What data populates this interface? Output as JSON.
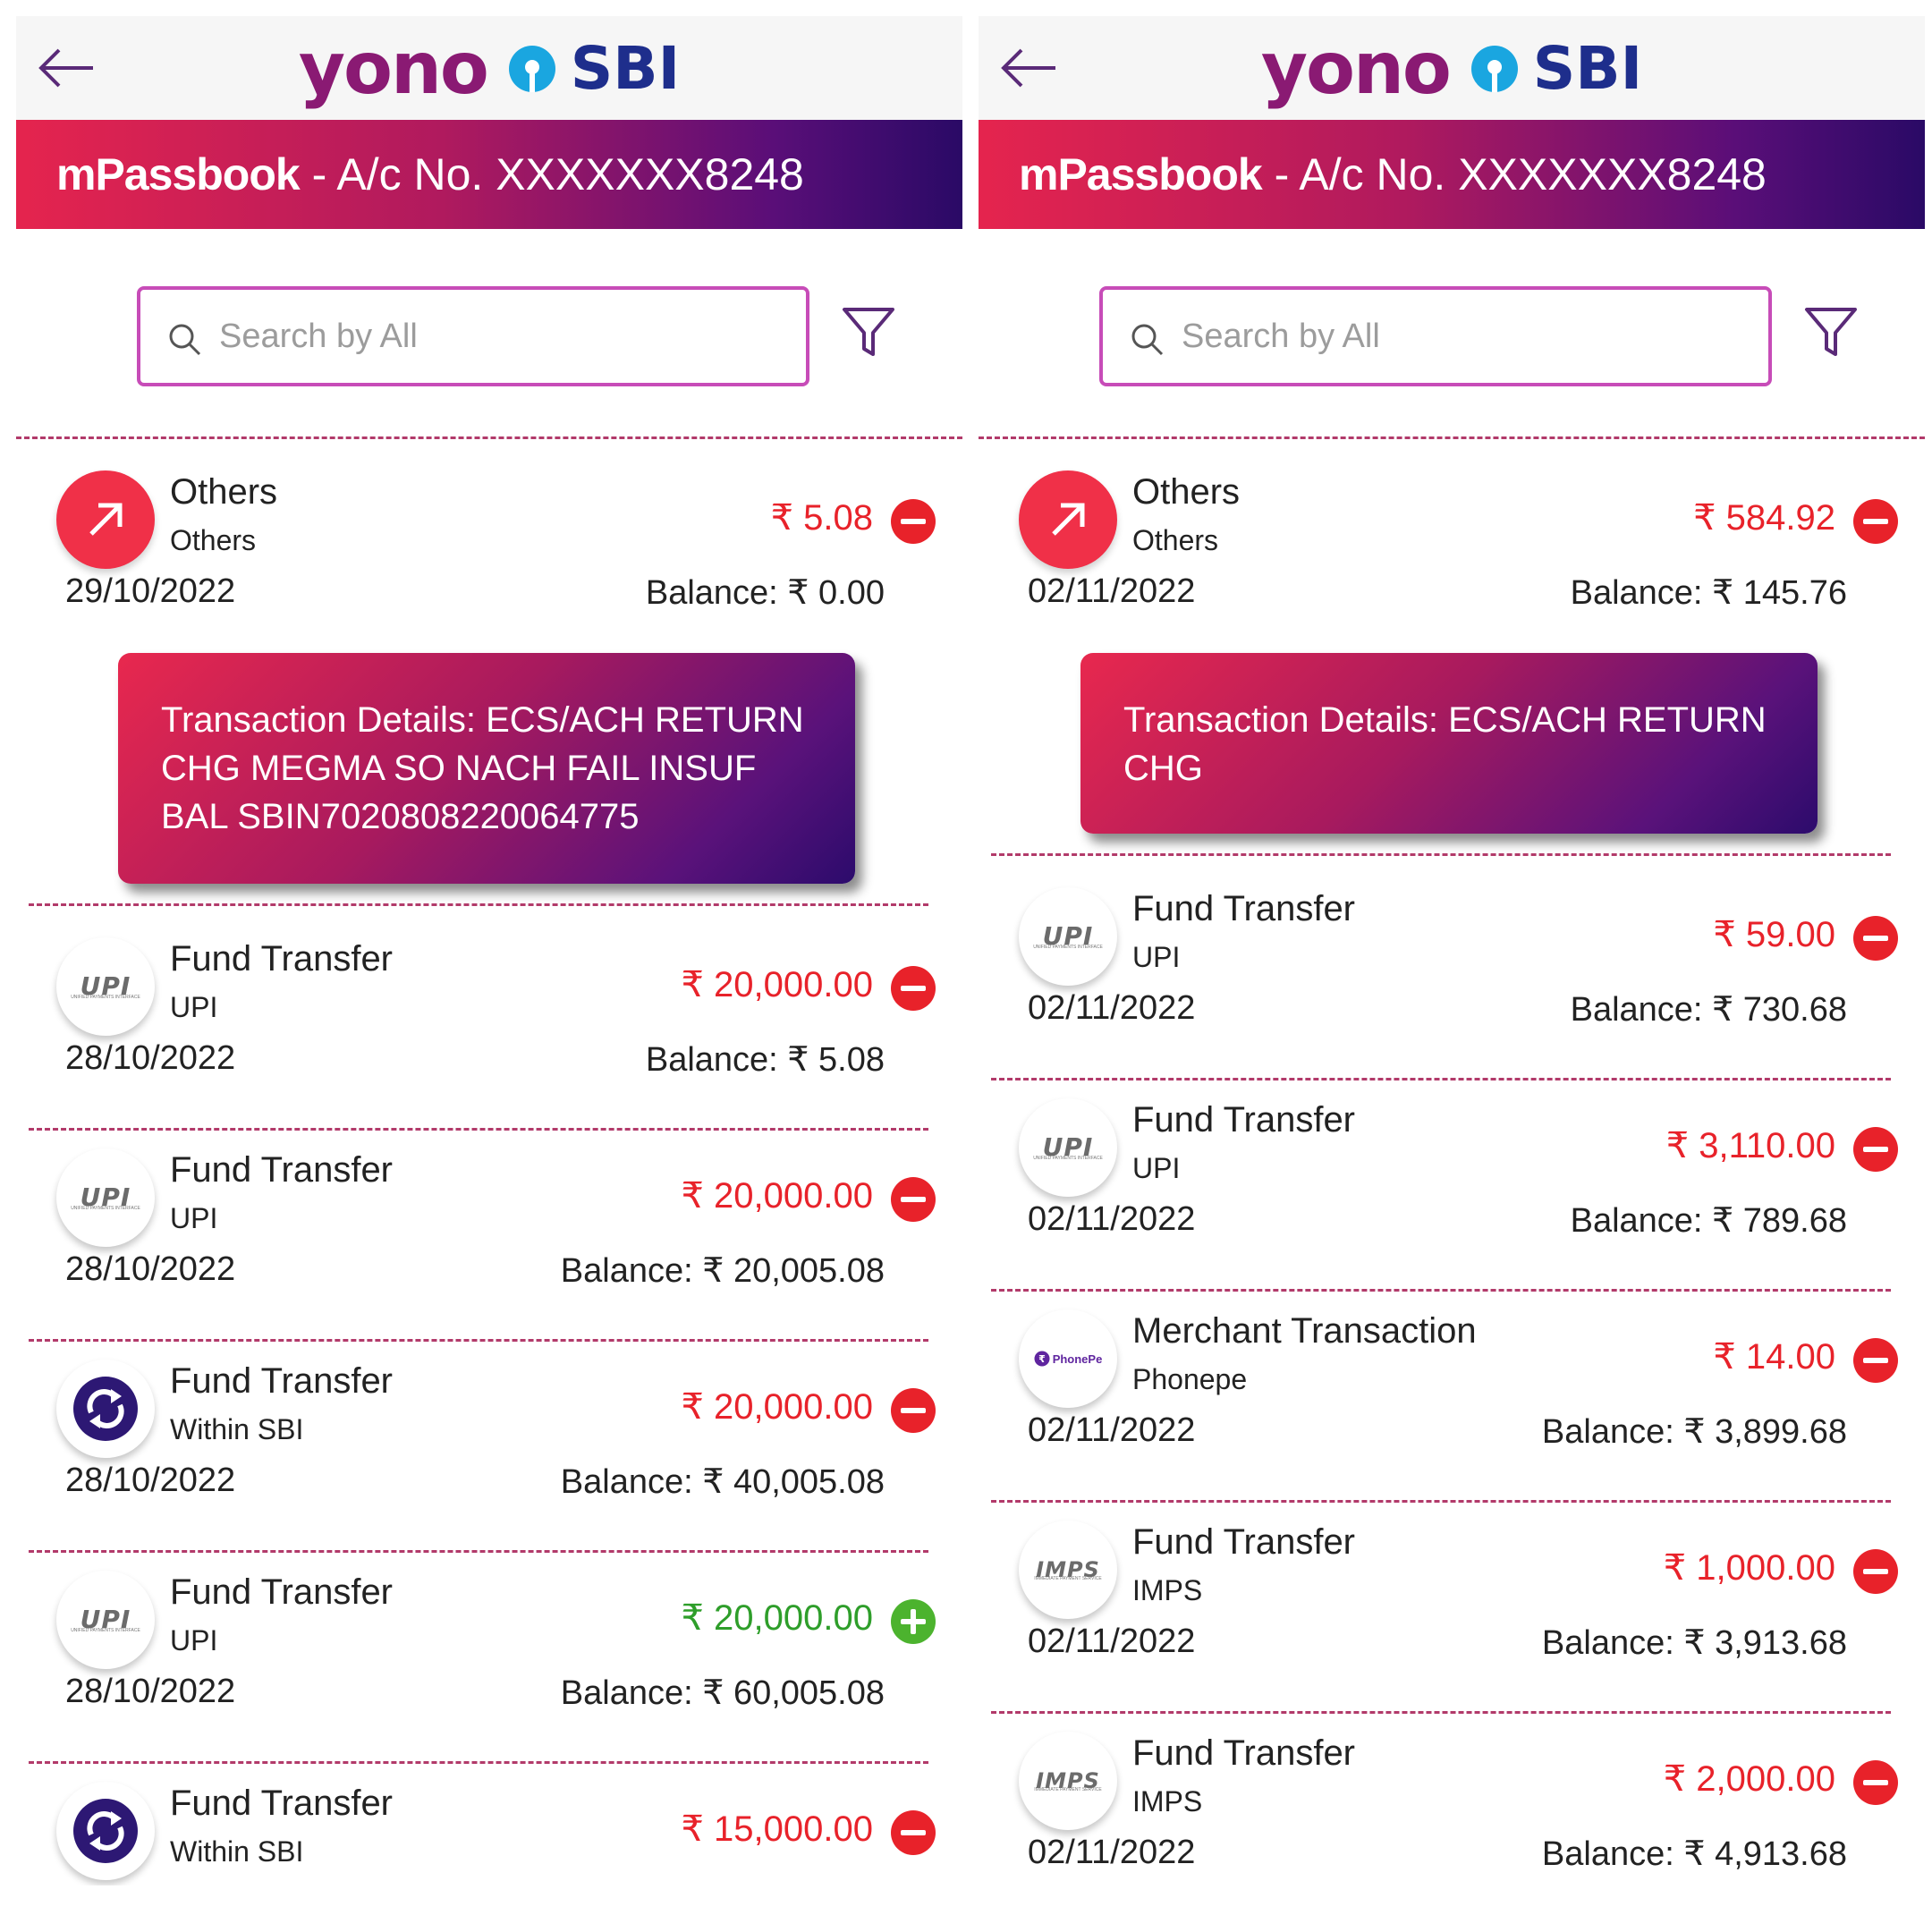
{
  "colors": {
    "brand_purple": "#8a1a73",
    "sbi_blue": "#1e2e8c",
    "debit": "#e8222a",
    "credit": "#2e9e2a",
    "search_border": "#c74cb8"
  },
  "icons": {
    "back": "arrow-left-icon",
    "search": "search-icon",
    "filter": "filter-funnel-icon",
    "others": "arrow-up-right-icon",
    "upi": "upi-logo-icon",
    "imps": "imps-logo-icon",
    "within_sbi": "sbi-transfer-icon",
    "phonepe": "phonepe-logo-icon",
    "debit": "minus-circle-icon",
    "credit": "plus-circle-icon"
  },
  "panels": [
    {
      "header": {
        "logo_yono": "yono",
        "logo_sbi": "SBI"
      },
      "account": {
        "title": "mPassbook",
        "separator": " - ",
        "number": "A/c No. XXXXXXX8248"
      },
      "search": {
        "placeholder": "Search by All"
      },
      "transactions": [
        {
          "icon": "others",
          "title": "Others",
          "sub": "Others",
          "amount": "₹ 5.08",
          "type": "debit",
          "date": "29/10/2022",
          "balance": "Balance:  ₹ 0.00",
          "details": "Transaction Details: ECS/ACH RETURN CHG MEGMA SO NACH FAIL INSUF BAL SBIN7020808220064775"
        },
        {
          "icon": "upi",
          "title": "Fund Transfer",
          "sub": "UPI",
          "amount": "₹ 20,000.00",
          "type": "debit",
          "date": "28/10/2022",
          "balance": "Balance:  ₹ 5.08"
        },
        {
          "icon": "upi",
          "title": "Fund Transfer",
          "sub": "UPI",
          "amount": "₹ 20,000.00",
          "type": "debit",
          "date": "28/10/2022",
          "balance": "Balance:  ₹ 20,005.08"
        },
        {
          "icon": "within_sbi",
          "title": "Fund Transfer",
          "sub": "Within SBI",
          "amount": "₹ 20,000.00",
          "type": "debit",
          "date": "28/10/2022",
          "balance": "Balance:  ₹ 40,005.08"
        },
        {
          "icon": "upi",
          "title": "Fund Transfer",
          "sub": "UPI",
          "amount": "₹ 20,000.00",
          "type": "credit",
          "date": "28/10/2022",
          "balance": "Balance:  ₹ 60,005.08"
        },
        {
          "icon": "within_sbi",
          "title": "Fund Transfer",
          "sub": "Within SBI",
          "amount": "₹ 15,000.00",
          "type": "debit",
          "date": "",
          "balance": ""
        }
      ]
    },
    {
      "header": {
        "logo_yono": "yono",
        "logo_sbi": "SBI"
      },
      "account": {
        "title": "mPassbook",
        "separator": " - ",
        "number": "A/c No. XXXXXXX8248"
      },
      "search": {
        "placeholder": "Search by All"
      },
      "transactions": [
        {
          "icon": "others",
          "title": "Others",
          "sub": "Others",
          "amount": "₹ 584.92",
          "type": "debit",
          "date": "02/11/2022",
          "balance": "Balance:  ₹ 145.76",
          "details": "Transaction Details: ECS/ACH RETURN CHG"
        },
        {
          "icon": "upi",
          "title": "Fund Transfer",
          "sub": "UPI",
          "amount": "₹ 59.00",
          "type": "debit",
          "date": "02/11/2022",
          "balance": "Balance:  ₹ 730.68"
        },
        {
          "icon": "upi",
          "title": "Fund Transfer",
          "sub": "UPI",
          "amount": "₹ 3,110.00",
          "type": "debit",
          "date": "02/11/2022",
          "balance": "Balance:  ₹ 789.68"
        },
        {
          "icon": "phonepe",
          "title": "Merchant Transaction",
          "sub": "Phonepe",
          "amount": "₹ 14.00",
          "type": "debit",
          "date": "02/11/2022",
          "balance": "Balance:  ₹ 3,899.68"
        },
        {
          "icon": "imps",
          "title": "Fund Transfer",
          "sub": "IMPS",
          "amount": "₹ 1,000.00",
          "type": "debit",
          "date": "02/11/2022",
          "balance": "Balance:  ₹ 3,913.68"
        },
        {
          "icon": "imps",
          "title": "Fund Transfer",
          "sub": "IMPS",
          "amount": "₹ 2,000.00",
          "type": "debit",
          "date": "02/11/2022",
          "balance": "Balance:  ₹ 4,913.68"
        }
      ]
    }
  ],
  "logo_captions": {
    "upi_mark": "UPI",
    "upi_caption": "UNIFIED PAYMENTS INTERFACE",
    "imps_mark": "IMPS",
    "imps_caption": "IMMEDIATE PAYMENT SERVICE",
    "phonepe": "PhonePe"
  }
}
